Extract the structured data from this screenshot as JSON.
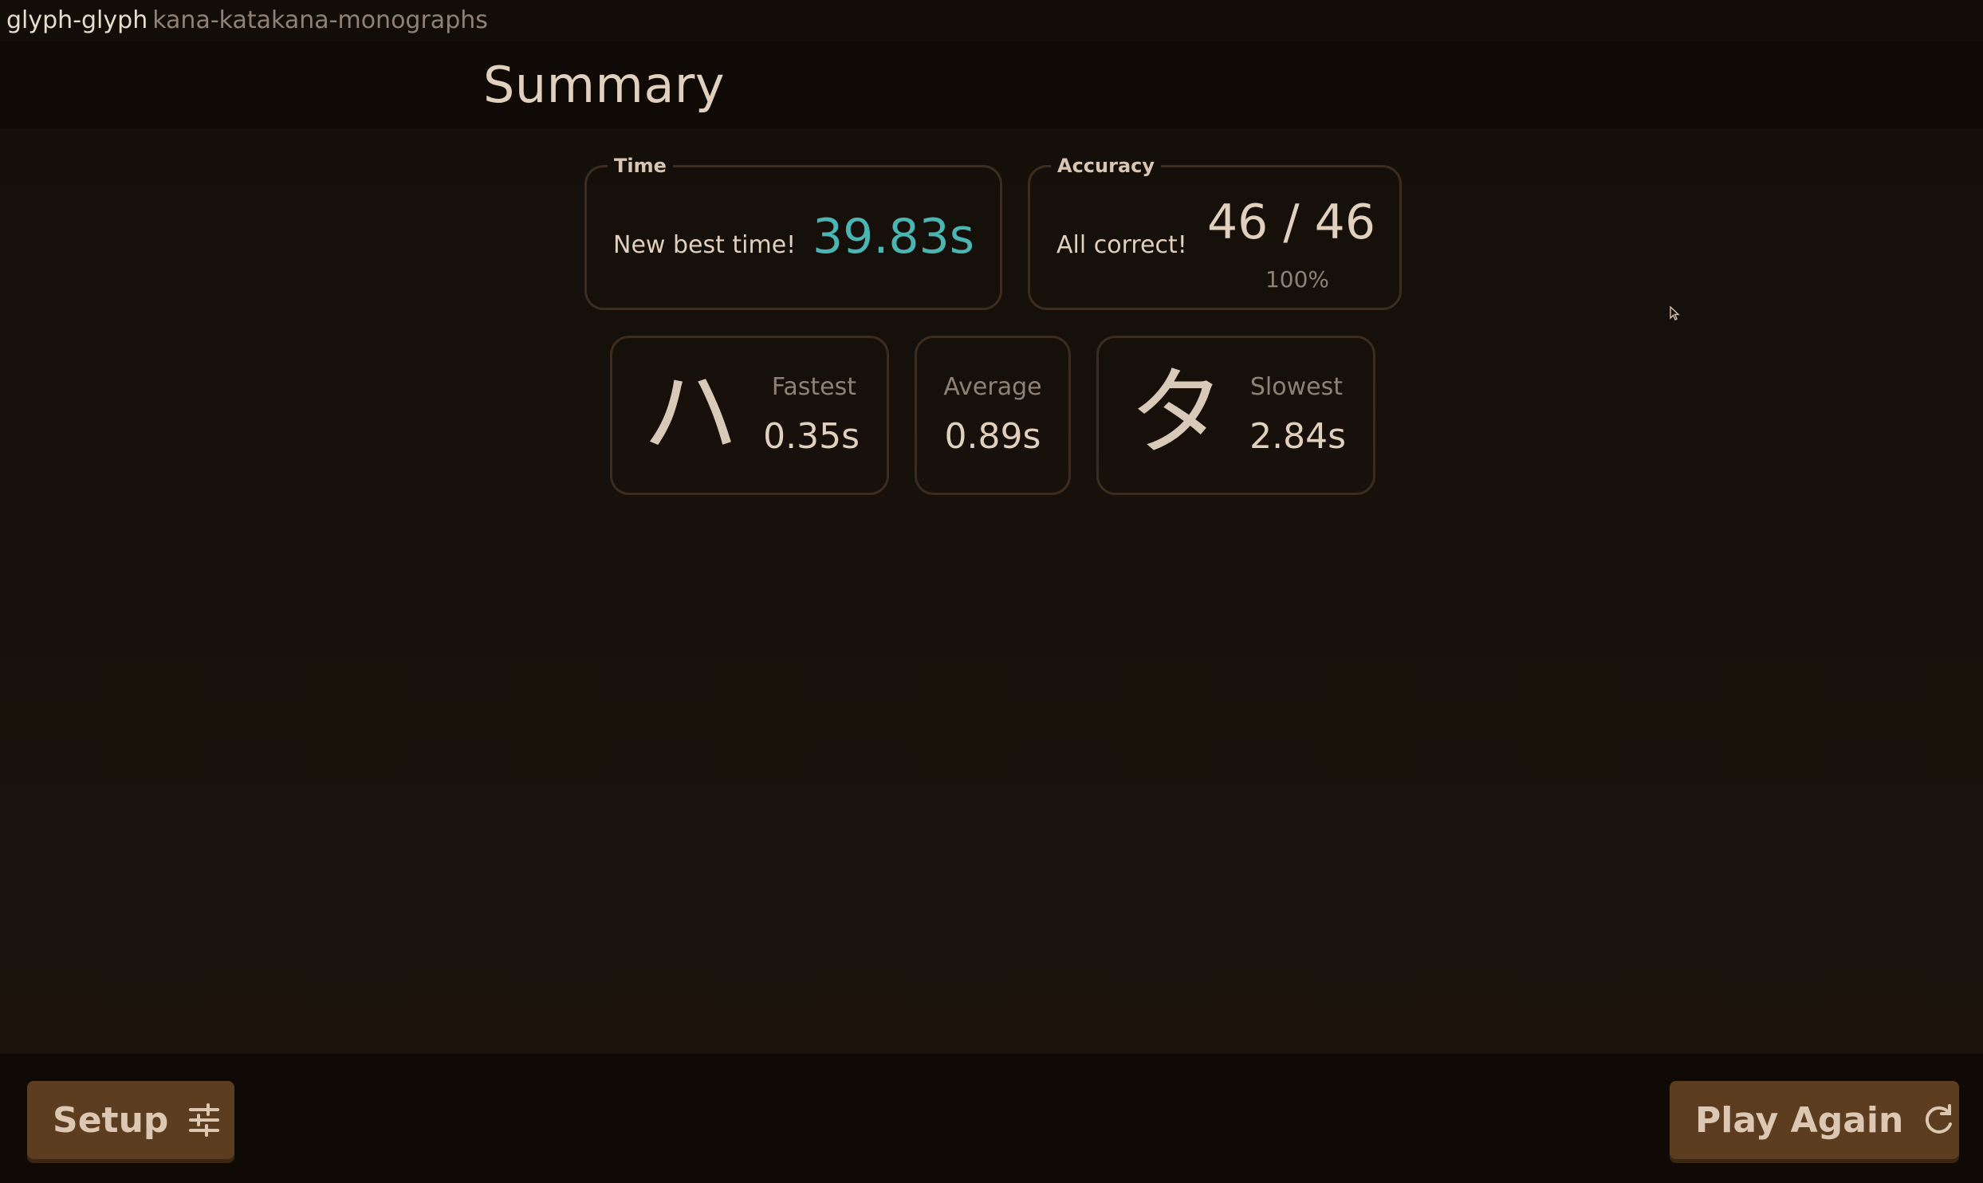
{
  "titlebar": {
    "app_name": "glyph-glyph",
    "deck_name": "kana-katakana-monographs"
  },
  "header": {
    "title": "Summary"
  },
  "time": {
    "legend": "Time",
    "message": "New best time!",
    "value": "39.83s",
    "value_color": "#4ab5b3"
  },
  "accuracy": {
    "legend": "Accuracy",
    "message": "All correct!",
    "score": "46 / 46",
    "percent": "100%"
  },
  "fastest": {
    "glyph": "ハ",
    "label": "Fastest",
    "value": "0.35s"
  },
  "average": {
    "label": "Average",
    "value": "0.89s"
  },
  "slowest": {
    "glyph": "タ",
    "label": "Slowest",
    "value": "2.84s"
  },
  "footer": {
    "setup_label": "Setup",
    "setup_icon": "sliders-icon",
    "play_again_label": "Play Again",
    "play_again_icon": "refresh-icon"
  },
  "colors": {
    "background": "#150f0a",
    "button": "#5c3d20",
    "accent": "#4ab5b3"
  }
}
